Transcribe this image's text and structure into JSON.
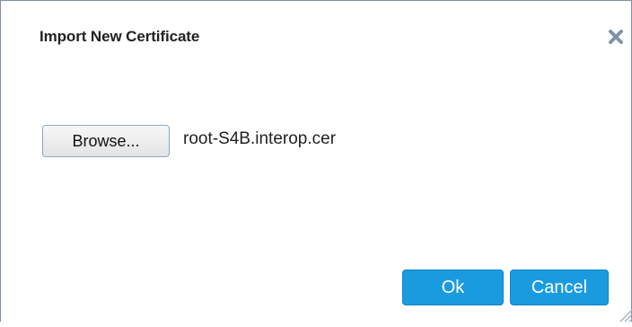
{
  "dialog": {
    "title": "Import New Certificate",
    "close_icon": "close-icon",
    "browse_label": "Browse...",
    "file_name": "root-S4B.interop.cer",
    "ok_label": "Ok",
    "cancel_label": "Cancel",
    "resize_icon": "resize-grip-icon"
  },
  "colors": {
    "primary_button": "#1a9be0",
    "close_icon": "#7f93a8",
    "border": "#7f8fa6"
  }
}
